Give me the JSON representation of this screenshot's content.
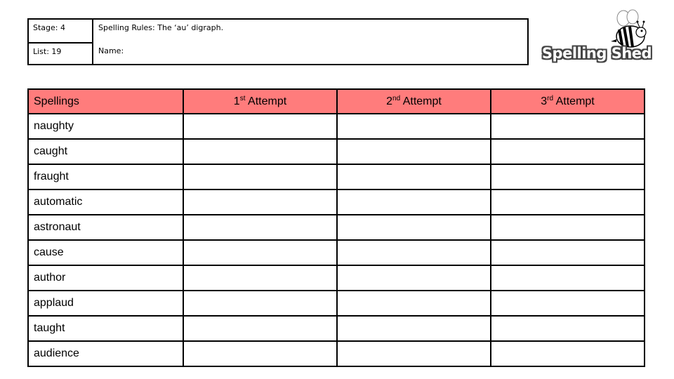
{
  "info": {
    "stage": "Stage: 4",
    "list": "List: 19",
    "spelling_rules": "Spelling Rules: The ‘au’ digraph.",
    "name_label": "Name:"
  },
  "logo": {
    "text": "Spelling Shed",
    "mascot": "bee-icon"
  },
  "table": {
    "header": {
      "spellings": "Spellings",
      "attempts": [
        {
          "num": "1",
          "suffix": "st",
          "label": " Attempt"
        },
        {
          "num": "2",
          "suffix": "nd",
          "label": " Attempt"
        },
        {
          "num": "3",
          "suffix": "rd",
          "label": " Attempt"
        }
      ]
    },
    "words": [
      "naughty",
      "caught",
      "fraught",
      "automatic",
      "astronaut",
      "cause",
      "author",
      "applaud",
      "taught",
      "audience"
    ],
    "header_color": "#ff7c7c"
  }
}
